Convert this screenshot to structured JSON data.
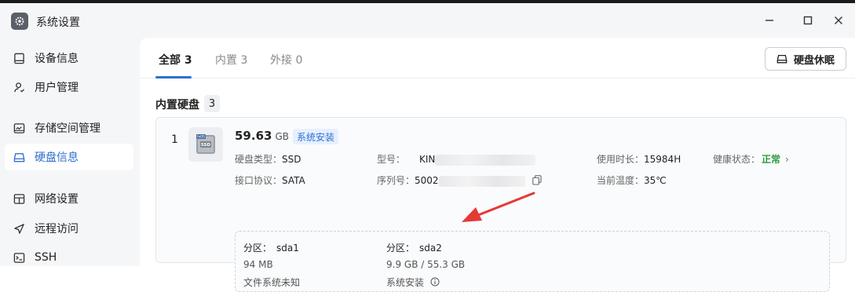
{
  "window": {
    "title": "系统设置",
    "controls": {
      "minimize": "—",
      "maximize": "☐",
      "close": "✕"
    }
  },
  "sidebar": {
    "items": [
      {
        "label": "设备信息",
        "icon": "device-icon",
        "active": false
      },
      {
        "label": "用户管理",
        "icon": "user-icon",
        "active": false
      },
      {
        "label": "存储空间管理",
        "icon": "storage-icon",
        "active": false
      },
      {
        "label": "硬盘信息",
        "icon": "disk-icon",
        "active": true
      },
      {
        "label": "网络设置",
        "icon": "network-icon",
        "active": false
      },
      {
        "label": "远程访问",
        "icon": "remote-icon",
        "active": false
      },
      {
        "label": "SSH",
        "icon": "ssh-icon",
        "active": false
      }
    ]
  },
  "tabs": [
    {
      "label": "全部 3",
      "active": true
    },
    {
      "label": "内置 3",
      "active": false
    },
    {
      "label": "外接 0",
      "active": false
    }
  ],
  "actions": {
    "sleep_label": "硬盘休眠"
  },
  "section": {
    "title": "内置硬盘",
    "count": "3"
  },
  "disk": {
    "index": "1",
    "thumb_label": "SSD",
    "thumb_brand": "fnOS",
    "capacity": "59.63",
    "capacity_unit": "GB",
    "badge": "系统安装",
    "type_label": "硬盘类型：",
    "type_value": "SSD",
    "iface_label": "接口协议：",
    "iface_value": "SATA",
    "model_label": "型号：",
    "model_value": "KIN",
    "serial_label": "序列号：",
    "serial_value": "5002",
    "uptime_label": "使用时长：",
    "uptime_value": "15984H",
    "temp_label": "当前温度：",
    "temp_value": "35℃",
    "health_label": "健康状态：",
    "health_value": "正常"
  },
  "partitions": [
    {
      "head_label": "分区：",
      "name": "sda1",
      "size": "94 MB",
      "note": "文件系统未知"
    },
    {
      "head_label": "分区：",
      "name": "sda2",
      "size": "9.9 GB / 55.3 GB",
      "note": "系统安装"
    }
  ],
  "colors": {
    "accent": "#2f6fd1",
    "healthy": "#2f9a3c",
    "annotation_arrow": "#e53935"
  }
}
